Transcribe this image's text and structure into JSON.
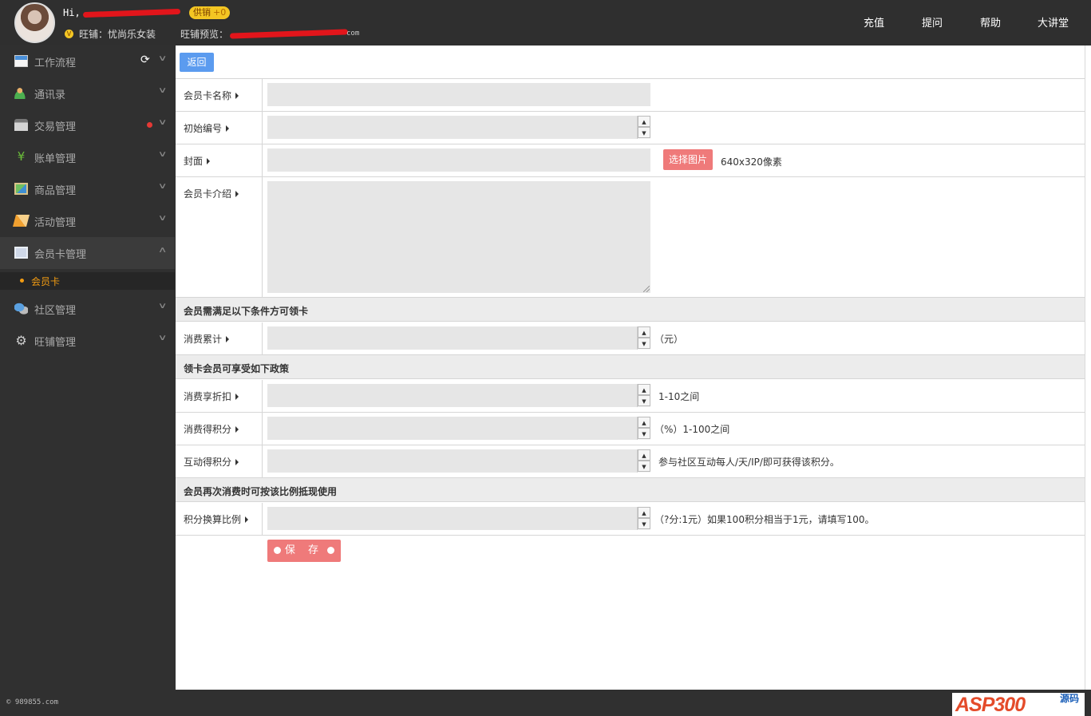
{
  "header": {
    "greeting": "Hi,",
    "badge_label": "供销",
    "badge_count": "+0",
    "shop_label": "旺铺：忧尚乐女装",
    "preview_label": "旺铺预览：",
    "preview_tail": "com",
    "nav": [
      "充值",
      "提问",
      "帮助",
      "大讲堂"
    ]
  },
  "sidebar": {
    "items": [
      {
        "label": "工作流程",
        "icon": "workflow-icon"
      },
      {
        "label": "通讯录",
        "icon": "contacts-icon"
      },
      {
        "label": "交易管理",
        "icon": "trade-icon"
      },
      {
        "label": "账单管理",
        "icon": "yen-icon",
        "glyph": "¥"
      },
      {
        "label": "商品管理",
        "icon": "goods-icon"
      },
      {
        "label": "活动管理",
        "icon": "activity-icon"
      },
      {
        "label": "会员卡管理",
        "icon": "member-card-icon"
      },
      {
        "label": "社区管理",
        "icon": "community-icon"
      },
      {
        "label": "旺铺管理",
        "icon": "gear-icon",
        "glyph": "⚙"
      }
    ],
    "sub_item": "会员卡",
    "refresh_glyph": "⟳",
    "chevron_glyph": "∨",
    "chevron_up_glyph": "∧"
  },
  "form": {
    "back_label": "返回",
    "card_name_label": "会员卡名称",
    "initial_no_label": "初始编号",
    "cover_label": "封面",
    "pick_image_label": "选择图片",
    "cover_size_note": "640x320像素",
    "intro_label": "会员卡介绍",
    "section1": "会员需满足以下条件方可领卡",
    "spend_total_label": "消费累计",
    "spend_total_unit": "（元）",
    "section2": "领卡会员可享受如下政策",
    "discount_label": "消费享折扣",
    "discount_note": "1-10之间",
    "points_label": "消费得积分",
    "points_note": "（%）1-100之间",
    "interact_label": "互动得积分",
    "interact_note": "参与社区互动每人/天/IP/即可获得该积分。",
    "section3": "会员再次消费时可按该比例抵现使用",
    "ratio_label": "积分换算比例",
    "ratio_note": "（?分:1元）如果100积分相当于1元，请填写100。",
    "save_label": "保 存",
    "spin_up": "▲",
    "spin_down": "▼"
  },
  "footer": {
    "copyright": "© 989855.com",
    "logo_text": "ASP300",
    "logo_sub": "源码"
  },
  "colors": {
    "topbar": "#2f2f2f",
    "sidebar": "#303030",
    "accent_blue": "#5b9bef",
    "accent_red": "#ef7a7a",
    "active_orange": "#f39c12",
    "badge_yellow": "#f3c623"
  }
}
